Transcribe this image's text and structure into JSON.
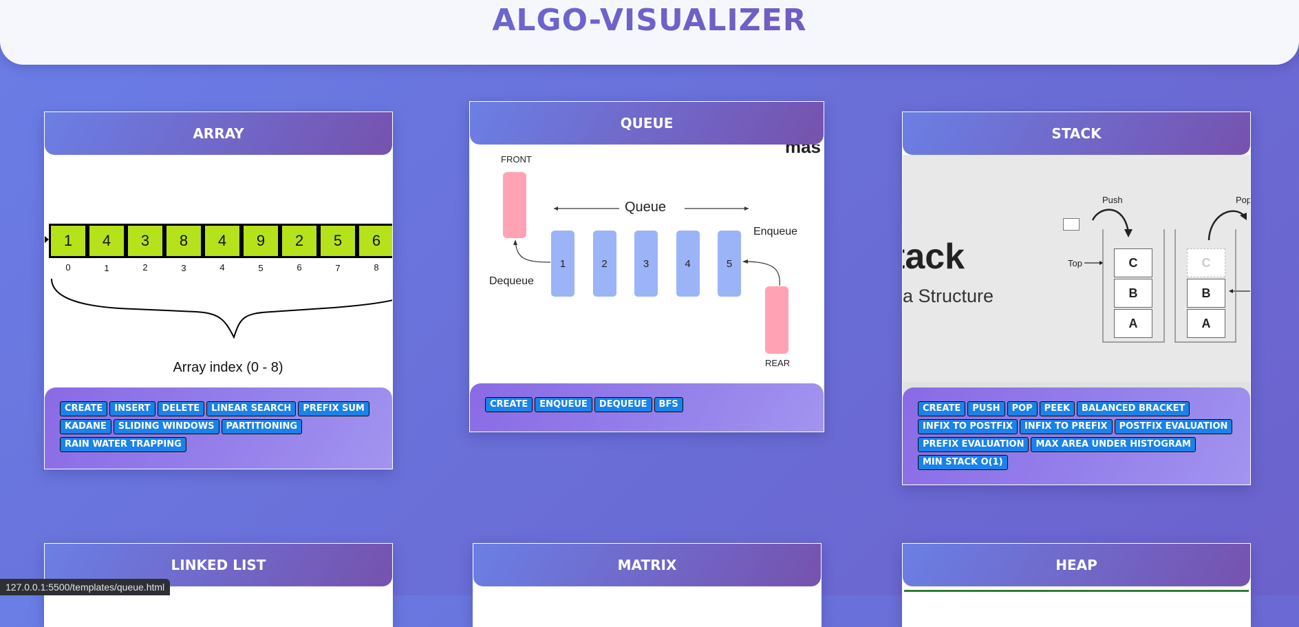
{
  "header": {
    "title": "ALGO-VISUALIZER"
  },
  "status_url": "127.0.0.1:5500/templates/queue.html",
  "cards": {
    "array": {
      "title": "ARRAY",
      "values": [
        "1",
        "4",
        "3",
        "8",
        "4",
        "9",
        "2",
        "5",
        "6"
      ],
      "indices": [
        "0",
        "1",
        "2",
        "3",
        "4",
        "5",
        "6",
        "7",
        "8"
      ],
      "caption": "Array index (0 - 8)",
      "ops": [
        "CREATE",
        "INSERT",
        "DELETE",
        "LINEAR SEARCH",
        "PREFIX SUM",
        "KADANE",
        "SLIDING WINDOWS",
        "PARTITIONING",
        "RAIN WATER TRAPPING"
      ]
    },
    "queue": {
      "title": "QUEUE",
      "front_label": "FRONT",
      "rear_label": "REAR",
      "queue_label": "Queue",
      "enqueue_label": "Enqueue",
      "dequeue_label": "Dequeue",
      "watermark": "mas",
      "items": [
        "1",
        "2",
        "3",
        "4",
        "5"
      ],
      "ops": [
        "CREATE",
        "ENQUEUE",
        "DEQUEUE",
        "BFS"
      ]
    },
    "stack": {
      "title": "STACK",
      "big_text": "tack",
      "subtitle": "a Structure",
      "push_label": "Push",
      "pop_label": "Pop",
      "top_label": "Top",
      "stack1": [
        "C",
        "B",
        "A"
      ],
      "stack2": [
        "C",
        "B",
        "A"
      ],
      "ops": [
        "CREATE",
        "PUSH",
        "POP",
        "PEEK",
        "BALANCED BRACKET",
        "INFIX TO POSTFIX",
        "INFIX TO PREFIX",
        "POSTFIX EVALUATION",
        "PREFIX EVALUATION",
        "MAX AREA UNDER HISTOGRAM",
        "MIN STACK O(1)"
      ]
    },
    "linked_list": {
      "title": "LINKED LIST"
    },
    "matrix": {
      "title": "MATRIX"
    },
    "heap": {
      "title": "HEAP"
    }
  },
  "colors": {
    "accent": "#6a70dc",
    "button": "#1a82e8",
    "array_cell": "#b5e21a",
    "queue_item": "#9bb3f7",
    "queue_end": "#ffa3b4"
  }
}
